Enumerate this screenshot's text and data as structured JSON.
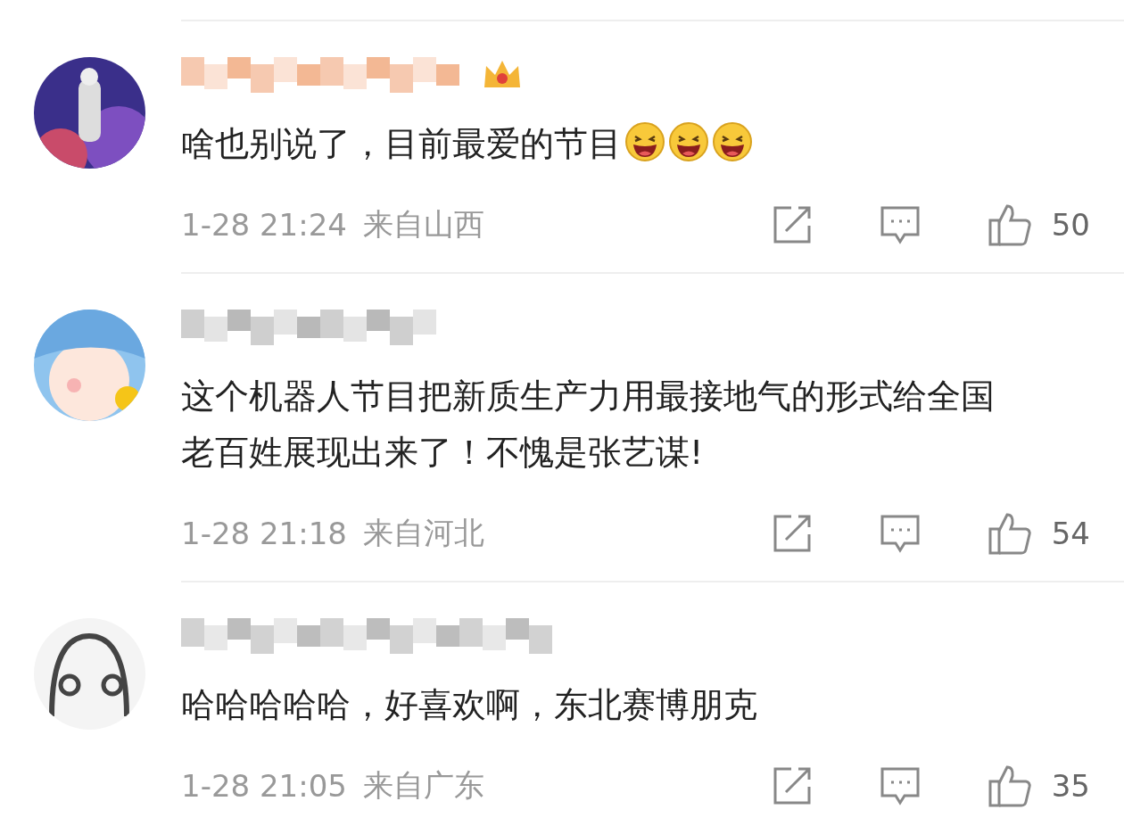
{
  "comments": [
    {
      "crown": true,
      "text": "啥也别说了，目前最爱的节目",
      "emojis": [
        {
          "kind": "laugh"
        },
        {
          "kind": "laugh"
        },
        {
          "kind": "laugh"
        }
      ],
      "time": "1-28 21:24",
      "location": "来自山西",
      "likes": "50"
    },
    {
      "crown": false,
      "text": "这个机器人节目把新质生产力用最接地气的形式给全国老百姓展现出来了！不愧是张艺谋!",
      "time": "1-28 21:18",
      "location": "来自河北",
      "likes": "54"
    },
    {
      "crown": false,
      "text": "哈哈哈哈哈，好喜欢啊，东北赛博朋克",
      "time": "1-28 21:05",
      "location": "来自广东",
      "likes": "35"
    }
  ]
}
